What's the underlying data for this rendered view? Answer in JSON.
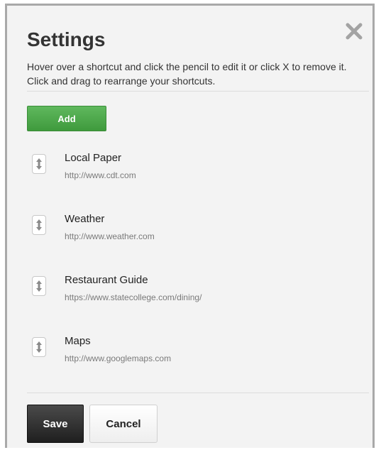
{
  "dialog": {
    "title": "Settings",
    "description": "Hover over a shortcut and click the pencil to edit it or click X to remove it. Click and drag to rearrange your shortcuts.",
    "close_icon": "close-x-icon"
  },
  "toolbar": {
    "add_label": "Add"
  },
  "shortcuts": [
    {
      "name": "Local Paper",
      "url": "http://www.cdt.com"
    },
    {
      "name": "Weather",
      "url": "http://www.weather.com"
    },
    {
      "name": "Restaurant Guide",
      "url": "https://www.statecollege.com/dining/"
    },
    {
      "name": "Maps",
      "url": "http://www.googlemaps.com"
    }
  ],
  "footer": {
    "save_label": "Save",
    "cancel_label": "Cancel"
  },
  "colors": {
    "panel_bg": "#f3f3f3",
    "add_button": "#4caf50",
    "save_button": "#2b2b2b",
    "text": "#333333",
    "url_text": "#7a7a7a"
  }
}
